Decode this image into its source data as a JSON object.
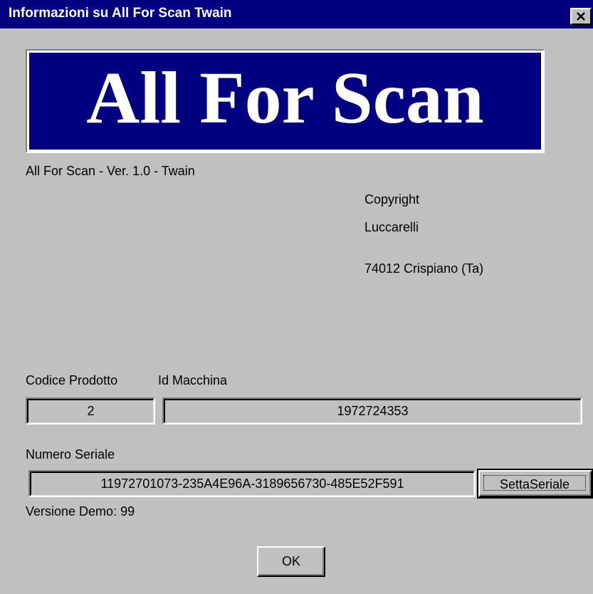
{
  "window": {
    "title": "Informazioni su All For Scan Twain",
    "close_icon": "close-icon"
  },
  "banner": {
    "text": "All For Scan",
    "background": "#000080",
    "text_color": "#ffffff"
  },
  "version_text": "All For Scan - Ver. 1.0  - Twain",
  "copyright": {
    "line1": "Copyright",
    "line2": "Luccarelli",
    "line3": "74012 Crispiano (Ta)"
  },
  "product_code": {
    "label": "Codice Prodotto",
    "value": "2"
  },
  "machine_id": {
    "label": "Id Macchina",
    "value": "1972724353"
  },
  "serial": {
    "label": "Numero Seriale",
    "value": "11972701073-235A4E96A-3189656730-485E52F591",
    "button_label": "SettaSeriale"
  },
  "demo_text": "Versione Demo: 99",
  "ok_label": "OK",
  "colors": {
    "face": "#c0c0c0",
    "titlebar": "#000080"
  }
}
